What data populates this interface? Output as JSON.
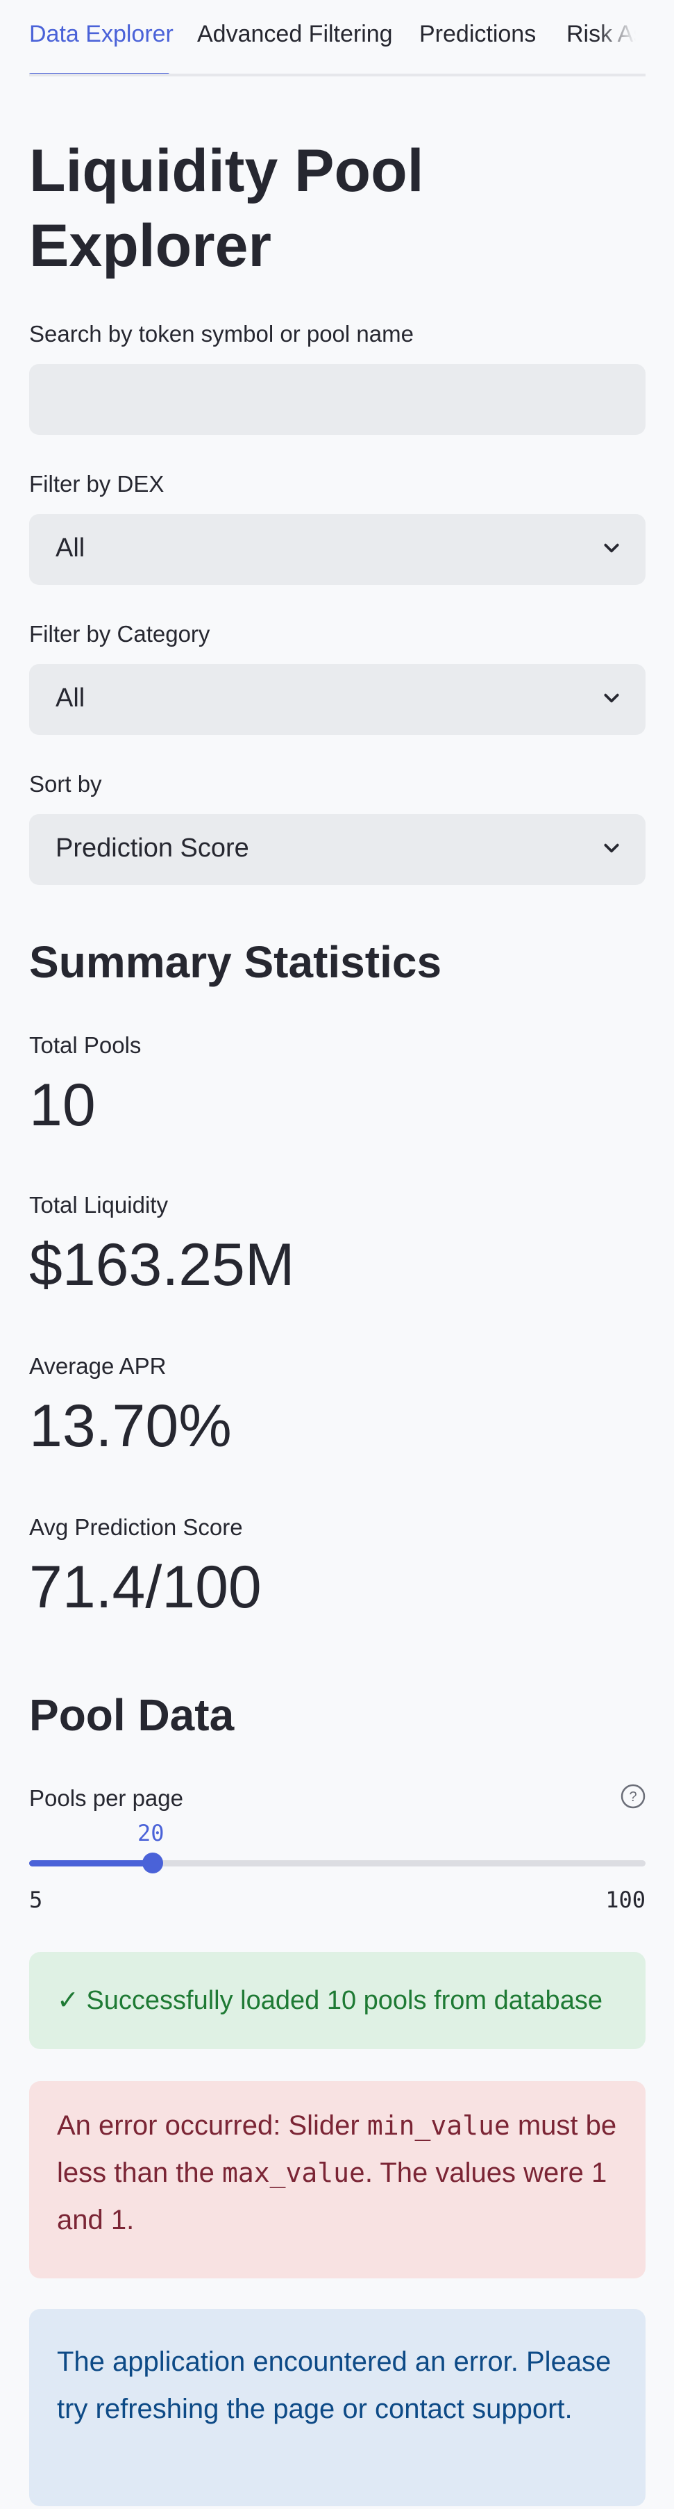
{
  "tabs": [
    {
      "label": "Data Explorer",
      "active": true
    },
    {
      "label": "Advanced Filtering",
      "active": false
    },
    {
      "label": "Predictions",
      "active": false
    },
    {
      "label": "Risk Assessment",
      "active": false
    }
  ],
  "title": "Liquidity Pool Explorer",
  "search": {
    "label": "Search by token symbol or pool name",
    "value": "",
    "placeholder": ""
  },
  "filters": {
    "dex": {
      "label": "Filter by DEX",
      "value": "All"
    },
    "category": {
      "label": "Filter by Category",
      "value": "All"
    },
    "sort": {
      "label": "Sort by",
      "value": "Prediction Score"
    }
  },
  "summary": {
    "heading": "Summary Statistics",
    "metrics": [
      {
        "label": "Total Pools",
        "value": "10"
      },
      {
        "label": "Total Liquidity",
        "value": "$163.25M"
      },
      {
        "label": "Average APR",
        "value": "13.70%"
      },
      {
        "label": "Avg Prediction Score",
        "value": "71.4/100"
      }
    ]
  },
  "pool_data": {
    "heading": "Pool Data",
    "slider": {
      "label": "Pools per page",
      "value": "20",
      "min": "5",
      "max": "100",
      "fraction": 0.2
    }
  },
  "alerts": {
    "success": "✓ Successfully loaded 10 pools from database",
    "error": {
      "p1": "An error occurred: Slider ",
      "code1": "min_value",
      "p2": " must be less than the ",
      "code2": "max_value",
      "p3": ". The values were 1 and 1."
    },
    "info": "The application encountered an error. Please try refreshing the page or contact support."
  },
  "colors": {
    "accent": "#4a62d8",
    "success": "#1e7a34",
    "error": "#7b2535",
    "info": "#0d4a86"
  }
}
